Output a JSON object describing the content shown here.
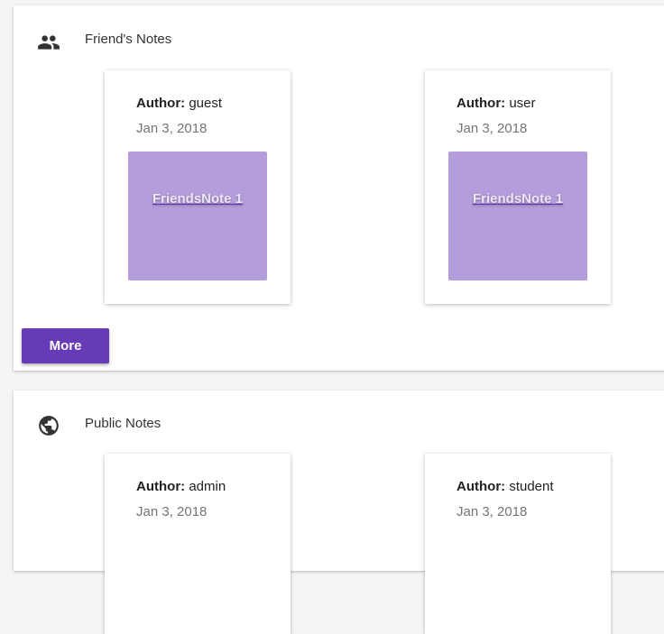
{
  "friends": {
    "title": "Friend's Notes",
    "icon": "people-icon",
    "notes": [
      {
        "author_label": "Author:",
        "author": "guest",
        "date": "Jan 3, 2018",
        "note_title": "FriendsNote 1"
      },
      {
        "author_label": "Author:",
        "author": "user",
        "date": "Jan 3, 2018",
        "note_title": "FriendsNote 1"
      }
    ],
    "more_label": "More"
  },
  "public": {
    "title": "Public Notes",
    "icon": "globe-icon",
    "notes": [
      {
        "author_label": "Author:",
        "author": "admin",
        "date": "Jan 3, 2018"
      },
      {
        "author_label": "Author:",
        "author": "student",
        "date": "Jan 3, 2018"
      }
    ]
  },
  "colors": {
    "accent": "#673ab7",
    "thumbnail": "#b39ddb"
  }
}
